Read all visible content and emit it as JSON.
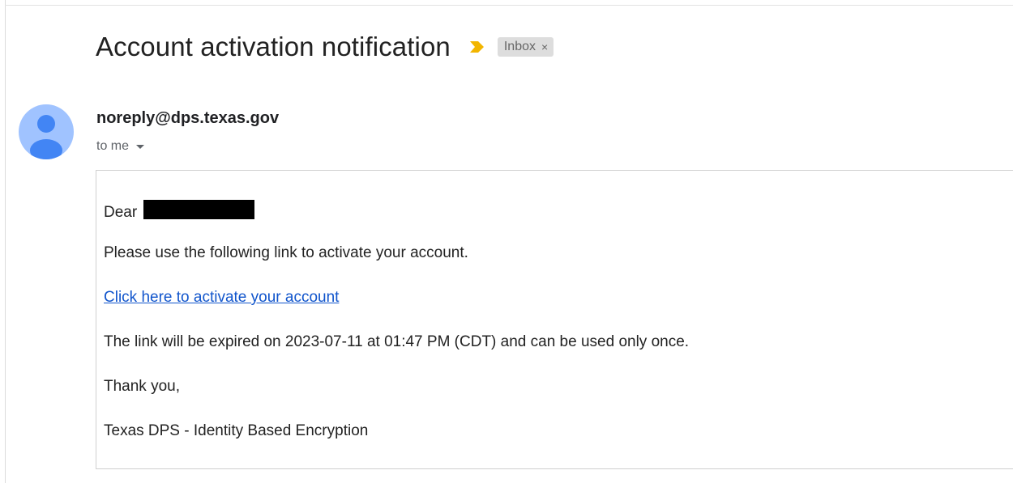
{
  "email": {
    "subject": "Account activation notification",
    "label": {
      "text": "Inbox",
      "close_glyph": "×"
    },
    "importance_icon": "importance-marker-icon",
    "sender": {
      "address": "noreply@dps.texas.gov",
      "avatar_icon": "person-avatar-icon",
      "avatar_color": "#a0c3ff",
      "avatar_figure_color": "#4285f4"
    },
    "recipient": {
      "text": "to me",
      "expand_icon": "caret-down-icon"
    },
    "body": {
      "greeting": "Dear",
      "intro": "Please use the following link to activate your account.",
      "link_text": "Click here to activate your account",
      "expiry": "The link will be expired on 2023-07-11 at 01:47 PM (CDT) and can be used only once.",
      "closing": "Thank you,",
      "signature": "Texas DPS - Identity Based Encryption"
    }
  },
  "colors": {
    "link": "#1155cc",
    "importance_marker": "#f2b500",
    "label_chip_bg": "#dddddd",
    "redaction": "#000000"
  }
}
